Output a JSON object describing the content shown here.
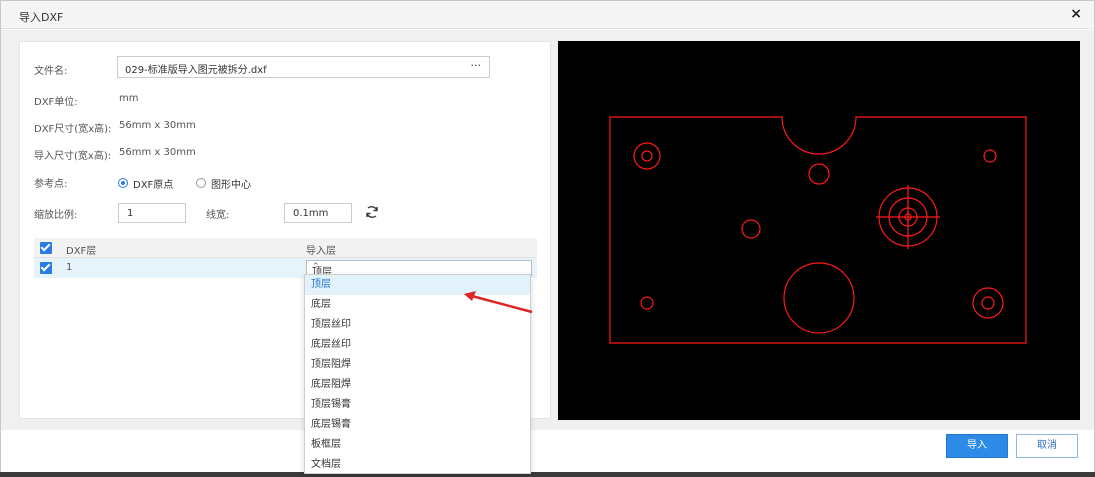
{
  "dialog": {
    "title": "导入DXF",
    "close_label": "×"
  },
  "form": {
    "file_label": "文件名:",
    "file_value": "029-标准版导入图元被拆分.dxf",
    "browse_label": "···",
    "unit_label": "DXF单位:",
    "unit_value": "mm",
    "dxf_size_label": "DXF尺寸(宽x高):",
    "dxf_size_value": "56mm x 30mm",
    "import_size_label": "导入尺寸(宽x高):",
    "import_size_value": "56mm x 30mm",
    "ref_label": "参考点:",
    "ref_options": [
      "DXF原点",
      "图形中心"
    ],
    "ref_selected": "DXF原点",
    "scale_label": "缩放比例:",
    "scale_value": "1",
    "linewidth_label": "线宽:",
    "linewidth_value": "0.1mm"
  },
  "table": {
    "headers": [
      "DXF层",
      "导入层"
    ],
    "rows": [
      {
        "dxf_layer": "1",
        "import_layer": "顶层",
        "checked": true
      }
    ]
  },
  "dropdown": {
    "options": [
      "顶层",
      "底层",
      "顶层丝印",
      "底层丝印",
      "顶层阻焊",
      "底层阻焊",
      "顶层锡膏",
      "底层锡膏",
      "板框层",
      "文档层"
    ],
    "selected": "顶层"
  },
  "footer": {
    "import_label": "导入",
    "cancel_label": "取消"
  },
  "colors": {
    "accent": "#2d8ae6",
    "preview_bg": "#000000",
    "preview_stroke": "#ff1a1a",
    "arrow": "#e02424"
  },
  "icons": {
    "refresh": "refresh-icon",
    "checkbox": "checkbox-icon",
    "chevron": "chevron-up-icon"
  }
}
